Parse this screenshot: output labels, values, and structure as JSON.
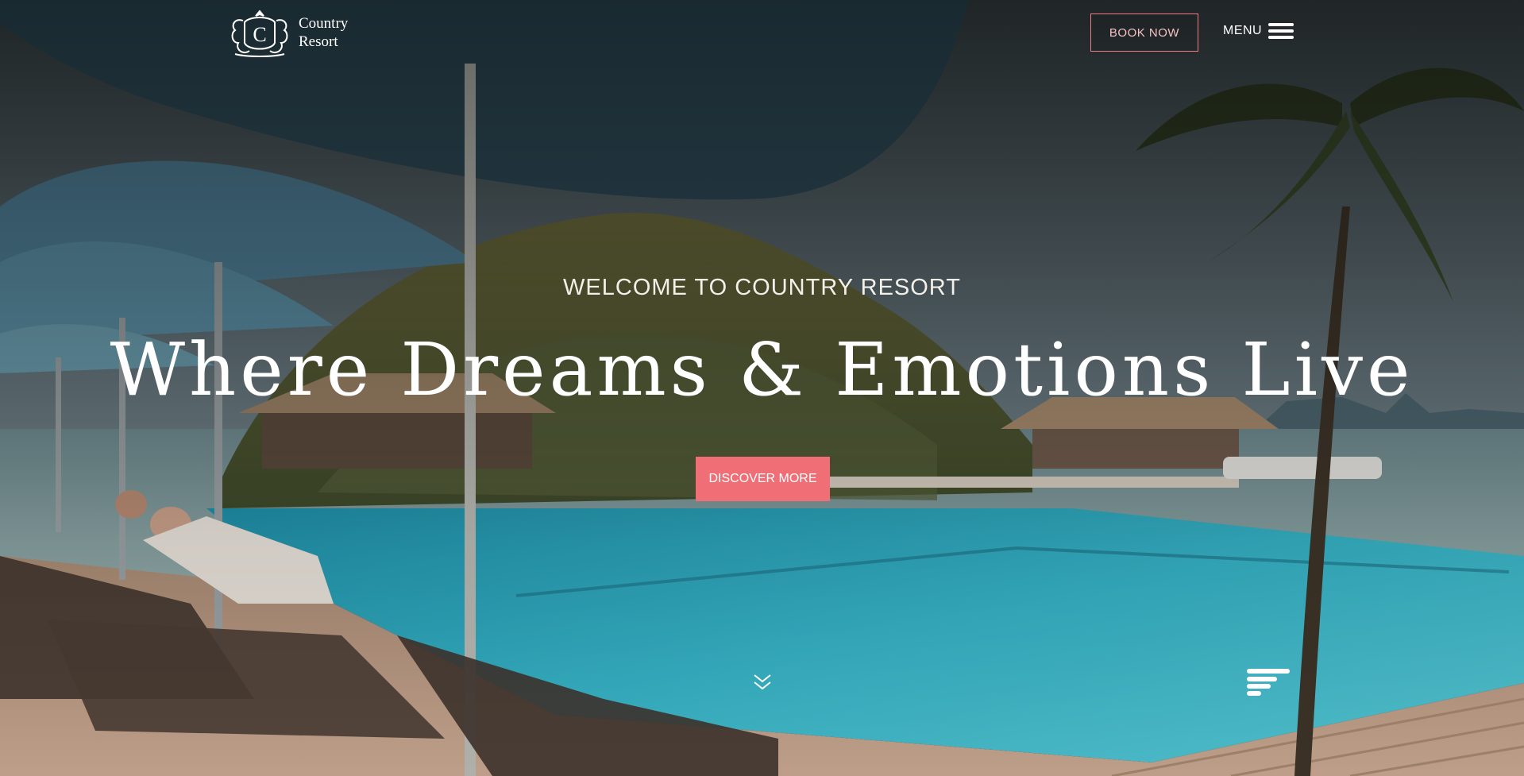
{
  "brand": {
    "logo_letter": "C",
    "name_line1": "Country",
    "name_line2": "Resort"
  },
  "header": {
    "book_label": "BOOK NOW",
    "menu_label": "MENU"
  },
  "hero": {
    "subtitle": "WELCOME TO COUNTRY RESORT",
    "title": "Where Dreams & Emotions Live",
    "cta_label": "DISCOVER MORE"
  },
  "icons": {
    "menu": "hamburger-icon",
    "scroll": "double-chevron-down-icon",
    "widget": "text-align-left-icon"
  },
  "colors": {
    "accent": "#f06e75",
    "book_border": "#f07b82",
    "text_light": "#ffffff"
  }
}
